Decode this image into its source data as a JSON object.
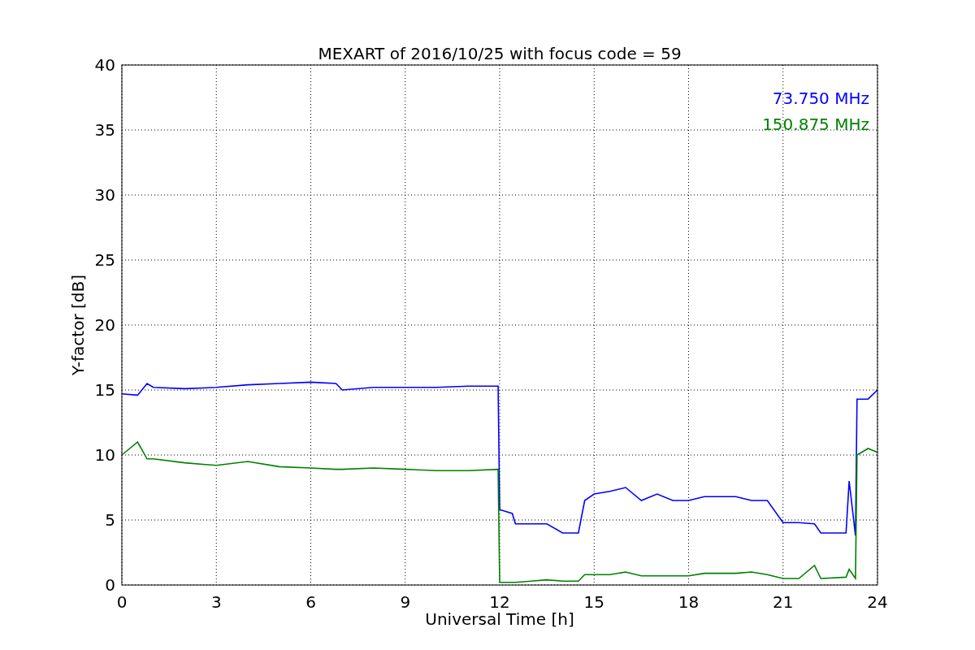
{
  "chart_data": {
    "type": "line",
    "title": "MEXART of 2016/10/25 with focus code = 59",
    "xlabel": "Universal Time [h]",
    "ylabel": "Y-factor [dB]",
    "x": [
      0,
      0.5,
      0.8,
      1,
      2,
      3,
      4,
      5,
      6,
      6.8,
      7,
      8,
      9,
      10,
      11,
      11.95,
      12,
      12.4,
      12.5,
      13,
      13.5,
      14,
      14.5,
      14.7,
      15,
      15.5,
      16,
      16.5,
      17,
      17.5,
      18,
      18.5,
      19,
      19.5,
      20,
      20.5,
      21,
      21.5,
      22,
      22.2,
      23,
      23.1,
      23.3,
      23.35,
      23.7,
      24
    ],
    "series": [
      {
        "name": "73.750 MHz",
        "color": "#0000ff",
        "values": [
          14.7,
          14.6,
          15.5,
          15.2,
          15.1,
          15.2,
          15.4,
          15.5,
          15.6,
          15.5,
          15.0,
          15.2,
          15.2,
          15.2,
          15.3,
          15.3,
          5.8,
          5.5,
          4.7,
          4.7,
          4.7,
          4.0,
          4.0,
          6.5,
          7.0,
          7.2,
          7.5,
          6.5,
          7.0,
          6.5,
          6.5,
          6.8,
          6.8,
          6.8,
          6.5,
          6.5,
          4.8,
          4.8,
          4.7,
          4.0,
          4.0,
          8.0,
          3.8,
          14.3,
          14.3,
          15.0
        ]
      },
      {
        "name": "150.875 MHz",
        "color": "#008000",
        "values": [
          10.0,
          11.0,
          9.7,
          9.7,
          9.4,
          9.2,
          9.5,
          9.1,
          9.0,
          8.9,
          8.9,
          9.0,
          8.9,
          8.8,
          8.8,
          8.9,
          0.2,
          0.2,
          0.2,
          0.3,
          0.4,
          0.3,
          0.3,
          0.8,
          0.8,
          0.8,
          1.0,
          0.7,
          0.7,
          0.7,
          0.7,
          0.9,
          0.9,
          0.9,
          1.0,
          0.8,
          0.5,
          0.5,
          1.5,
          0.5,
          0.6,
          1.2,
          0.5,
          10.0,
          10.5,
          10.2
        ]
      }
    ],
    "grid": true,
    "xlim": [
      0,
      24
    ],
    "ylim": [
      0,
      40
    ],
    "xticks": [
      0,
      3,
      6,
      9,
      12,
      15,
      18,
      21,
      24
    ],
    "yticks": [
      0,
      5,
      10,
      15,
      20,
      25,
      30,
      35,
      40
    ]
  }
}
